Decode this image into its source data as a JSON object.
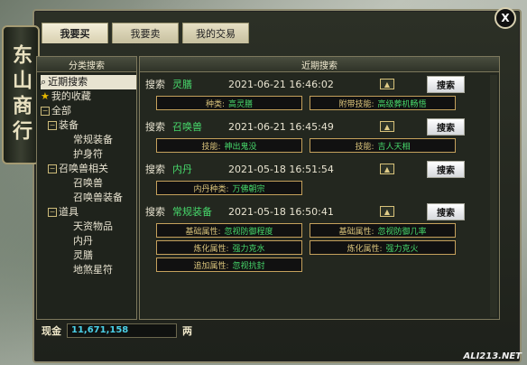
{
  "window": {
    "title": "东山商行",
    "close_label": "X"
  },
  "tabs": [
    {
      "label": "我要买",
      "active": true
    },
    {
      "label": "我要卖",
      "active": false
    },
    {
      "label": "我的交易",
      "active": false
    }
  ],
  "left_panel": {
    "header": "分类搜索",
    "items": [
      {
        "label": "近期搜索",
        "level": 0,
        "selected": true,
        "icon": "search-icon"
      },
      {
        "label": "我的收藏",
        "level": 0,
        "icon": "star-icon"
      },
      {
        "label": "全部",
        "level": 0,
        "toggle": "⊟"
      },
      {
        "label": "装备",
        "level": 1,
        "toggle": "⊟"
      },
      {
        "label": "常规装备",
        "level": 2
      },
      {
        "label": "护身符",
        "level": 2
      },
      {
        "label": "召唤兽相关",
        "level": 1,
        "toggle": "⊟"
      },
      {
        "label": "召唤兽",
        "level": 2
      },
      {
        "label": "召唤兽装备",
        "level": 2
      },
      {
        "label": "道具",
        "level": 1,
        "toggle": "⊟"
      },
      {
        "label": "天资物品",
        "level": 2
      },
      {
        "label": "内丹",
        "level": 2
      },
      {
        "label": "灵膳",
        "level": 2
      },
      {
        "label": "地煞星符",
        "level": 2
      }
    ]
  },
  "right_panel": {
    "header": "近期搜索",
    "search_label": "搜索",
    "search_button": "搜索",
    "records": [
      {
        "name": "灵膳",
        "time": "2021-06-21 16:46:02",
        "attrs": [
          {
            "k": "种类:",
            "v": "高灵膳"
          },
          {
            "k": "附带技能:",
            "v": "高级葬机畅悟"
          }
        ]
      },
      {
        "name": "召唤兽",
        "time": "2021-06-21 16:45:49",
        "attrs": [
          {
            "k": "技能:",
            "v": "神出鬼没"
          },
          {
            "k": "技能:",
            "v": "吉人天相"
          }
        ]
      },
      {
        "name": "内丹",
        "time": "2021-05-18 16:51:54",
        "attrs": [
          {
            "k": "内丹种类:",
            "v": "万佛朝宗"
          }
        ]
      },
      {
        "name": "常规装备",
        "time": "2021-05-18 16:50:41",
        "attrs": [
          {
            "k": "基础属性:",
            "v": "忽视防御程度"
          },
          {
            "k": "基础属性:",
            "v": "忽视防御几率"
          },
          {
            "k": "炼化属性:",
            "v": "强力克水"
          },
          {
            "k": "炼化属性:",
            "v": "强力克火"
          },
          {
            "k": "追加属性:",
            "v": "忽视抗封"
          }
        ]
      }
    ]
  },
  "footer": {
    "cash_label": "现金",
    "cash_value": "11,671,158",
    "cash_unit": "两"
  },
  "watermark": "ALI213.NET"
}
